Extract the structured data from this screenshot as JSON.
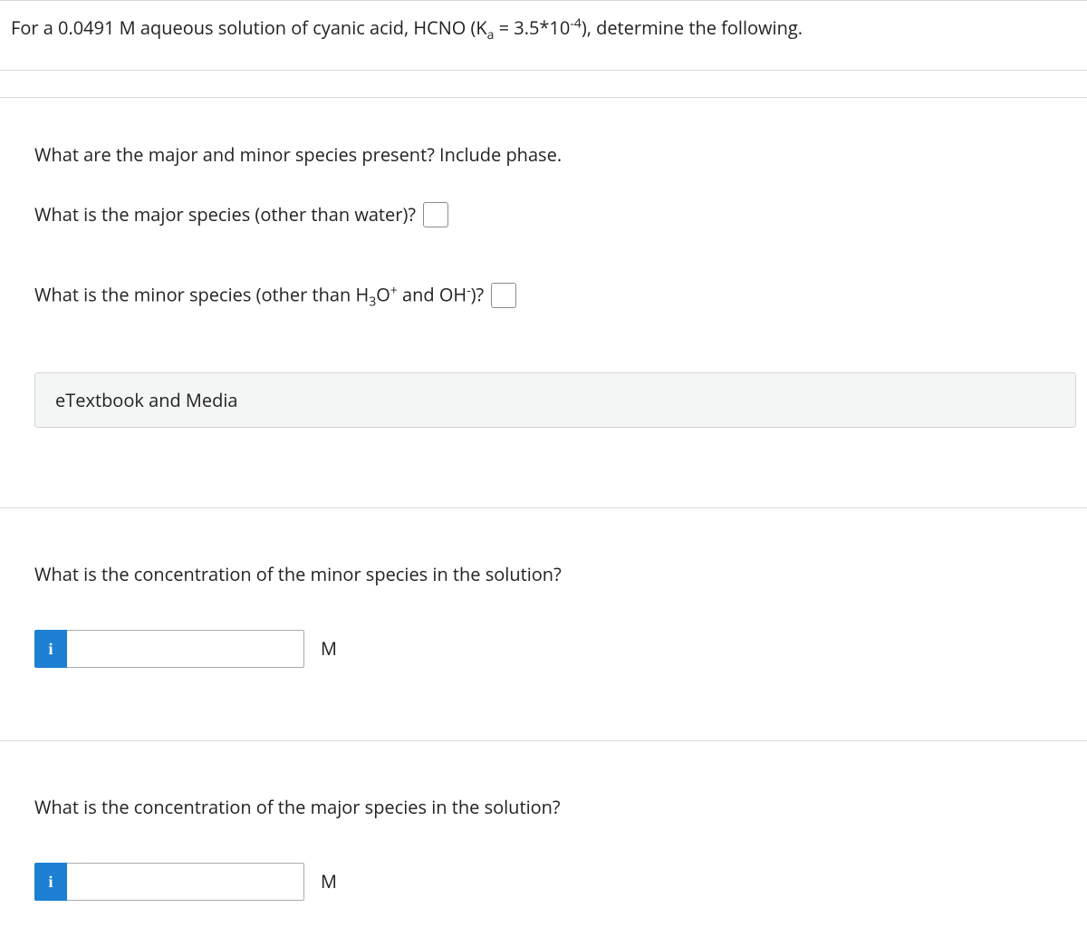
{
  "intro": {
    "prefix": "For a 0.0491 M aqueous solution of cyanic acid, HCNO (K",
    "sub": "a",
    "mid": " = 3.5*10",
    "sup": "-4",
    "suffix": "), determine the following."
  },
  "species": {
    "heading": "What are the major and minor species present? Include phase.",
    "major_q": "What is the major species (other than water)?",
    "minor_q_prefix": "What is the minor species (other than H",
    "minor_q_sub1": "3",
    "minor_q_mid1": "O",
    "minor_q_sup1": "+",
    "minor_q_mid2": " and OH",
    "minor_q_sup2": "-",
    "minor_q_suffix": ")?"
  },
  "etextbook_label": "eTextbook and Media",
  "minor_conc": {
    "question": "What is the concentration of the minor species in the solution?",
    "unit": "M"
  },
  "major_conc": {
    "question": "What is the concentration of the major species in the solution?",
    "unit": "M"
  },
  "info_icon_label": "i"
}
